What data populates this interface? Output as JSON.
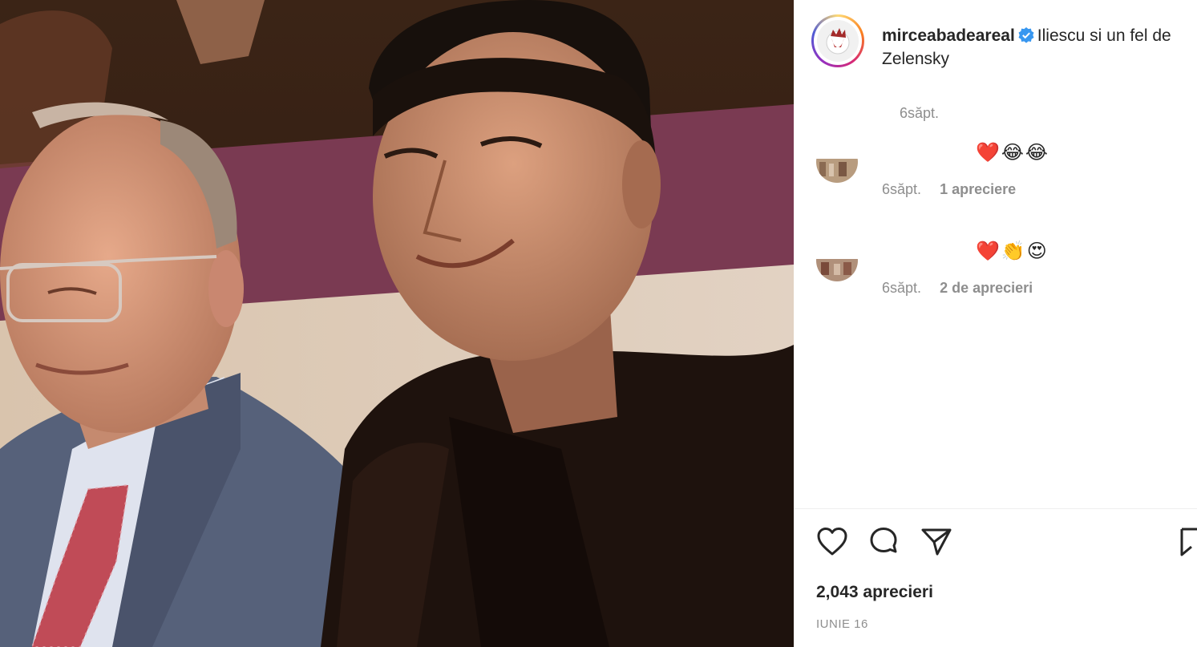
{
  "post": {
    "author": {
      "username": "mirceabadeareal",
      "avatar_icon": "wilson-ball-avatar",
      "verified_icon": "verified-badge-icon",
      "verified_color": "#3897f0"
    },
    "caption": "Iliescu si un fel de Zelensky",
    "caption_time": "6săpt.",
    "comments": [
      {
        "text": "❤️😂😂",
        "time": "6săpt.",
        "likes": "1 apreciere"
      },
      {
        "text": "❤️👏😍",
        "time": "6săpt.",
        "likes": "2 de aprecieri"
      }
    ],
    "actions": {
      "like_icon": "heart-icon",
      "comment_icon": "comment-icon",
      "share_icon": "send-icon",
      "save_icon": "bookmark-icon"
    },
    "likes_count": "2,043 aprecieri",
    "date": "IUNIE 16"
  }
}
